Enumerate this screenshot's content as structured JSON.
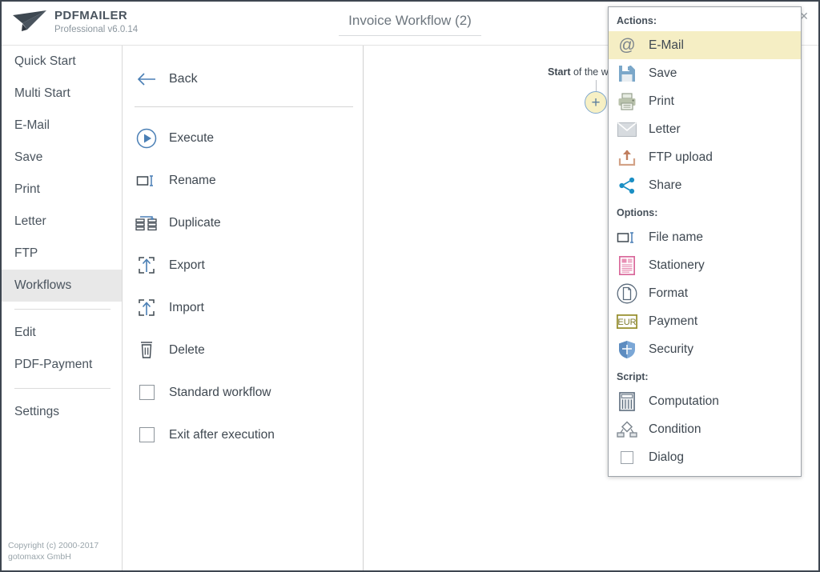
{
  "header": {
    "brand_name": "PDFMAILER",
    "brand_sub": "Professional v6.0.14",
    "logo_icon": "paper-plane-icon",
    "doc_title": "Invoice Workflow (2)",
    "close_label": "✕"
  },
  "sidebar": {
    "items": [
      {
        "label": "Quick Start",
        "active": false
      },
      {
        "label": "Multi Start",
        "active": false
      },
      {
        "label": "E-Mail",
        "active": false
      },
      {
        "label": "Save",
        "active": false
      },
      {
        "label": "Print",
        "active": false
      },
      {
        "label": "Letter",
        "active": false
      },
      {
        "label": "FTP",
        "active": false
      },
      {
        "label": "Workflows",
        "active": true
      },
      {
        "label": "Edit",
        "active": false
      },
      {
        "label": "PDF-Payment",
        "active": false
      },
      {
        "label": "Settings",
        "active": false
      }
    ],
    "copyright_line1": "Copyright (c) 2000-2017",
    "copyright_line2": "gotomaxx GmbH"
  },
  "midpanel": {
    "back_label": "Back",
    "back_icon": "arrow-left-icon",
    "actions": [
      {
        "label": "Execute",
        "icon": "play-circle-icon"
      },
      {
        "label": "Rename",
        "icon": "rename-icon"
      },
      {
        "label": "Duplicate",
        "icon": "duplicate-icon"
      },
      {
        "label": "Export",
        "icon": "export-icon"
      },
      {
        "label": "Import",
        "icon": "import-icon"
      },
      {
        "label": "Delete",
        "icon": "trash-icon"
      }
    ],
    "checkboxes": [
      {
        "label": "Standard workflow",
        "checked": false
      },
      {
        "label": "Exit after execution",
        "checked": false
      }
    ]
  },
  "canvas": {
    "start_bold": "Start",
    "start_rest": " of the w",
    "plus_label": "+",
    "plus_icon": "add-node-icon"
  },
  "contextmenu": {
    "groups": [
      {
        "title": "Actions:",
        "items": [
          {
            "label": "E-Mail",
            "icon": "at-icon",
            "selected": true
          },
          {
            "label": "Save",
            "icon": "floppy-disk-icon",
            "selected": false
          },
          {
            "label": "Print",
            "icon": "printer-icon",
            "selected": false
          },
          {
            "label": "Letter",
            "icon": "envelope-icon",
            "selected": false
          },
          {
            "label": "FTP upload",
            "icon": "upload-icon",
            "selected": false
          },
          {
            "label": "Share",
            "icon": "share-icon",
            "selected": false
          }
        ]
      },
      {
        "title": "Options:",
        "items": [
          {
            "label": "File name",
            "icon": "rename-icon",
            "selected": false
          },
          {
            "label": "Stationery",
            "icon": "stationery-icon",
            "selected": false
          },
          {
            "label": "Format",
            "icon": "page-circle-icon",
            "selected": false
          },
          {
            "label": "Payment",
            "icon": "eur-icon",
            "selected": false
          },
          {
            "label": "Security",
            "icon": "shield-icon",
            "selected": false
          }
        ]
      },
      {
        "title": "Script:",
        "items": [
          {
            "label": "Computation",
            "icon": "calculator-icon",
            "selected": false
          },
          {
            "label": "Condition",
            "icon": "condition-icon",
            "selected": false
          },
          {
            "label": "Dialog",
            "icon": "dialog-icon",
            "selected": false
          }
        ]
      }
    ]
  },
  "colors": {
    "accent_blue": "#4a7fb5",
    "text_dark": "#3f4851",
    "text_muted": "#8b969e",
    "highlight_yellow": "#f5eec4",
    "sidebar_active": "#e8e8e8",
    "window_border": "#3e4650",
    "ftp_orange": "#c98b6e",
    "share_blue": "#1b8fc4",
    "stationery_pink": "#d96a9a",
    "payment_olive": "#9a9233"
  }
}
